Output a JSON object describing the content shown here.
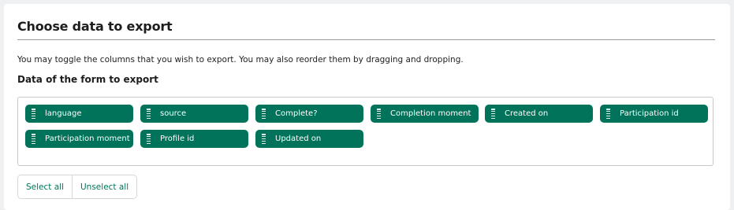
{
  "section": {
    "title": "Choose data to export",
    "description": "You may toggle the columns that you wish to export. You may also reorder them by dragging and dropping.",
    "subtitle": "Data of the form to export"
  },
  "columns": [
    "language",
    "source",
    "Complete?",
    "Completion moment",
    "Created on",
    "Participation id",
    "Participation moment",
    "Profile id",
    "Updated on"
  ],
  "actions": {
    "select_all": "Select all",
    "unselect_all": "Unselect all"
  },
  "colors": {
    "chip": "#00735a",
    "accent_text": "#00735a"
  }
}
